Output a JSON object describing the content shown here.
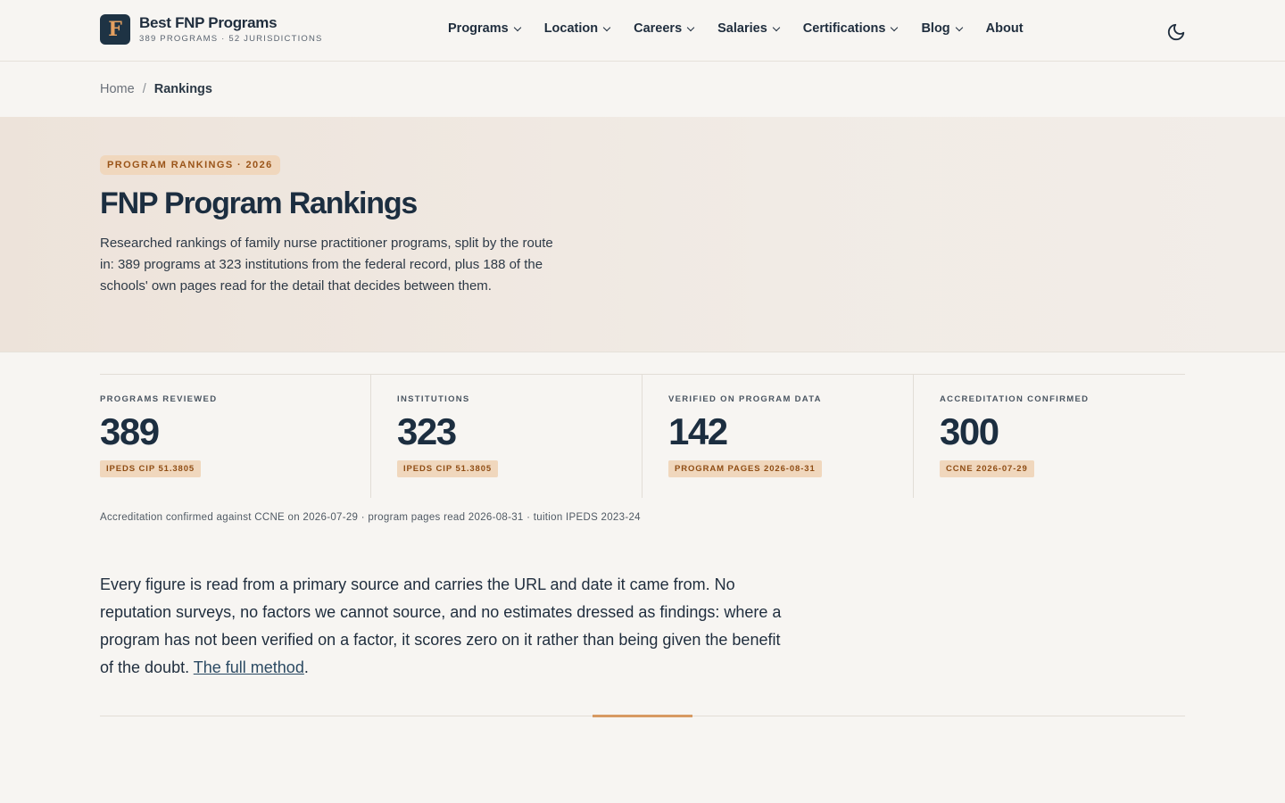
{
  "brand": {
    "logo_letter": "F",
    "name": "Best FNP Programs",
    "subtitle": "389 PROGRAMS · 52 JURISDICTIONS"
  },
  "nav": [
    {
      "label": "Programs",
      "has_dropdown": true
    },
    {
      "label": "Location",
      "has_dropdown": true
    },
    {
      "label": "Careers",
      "has_dropdown": true
    },
    {
      "label": "Salaries",
      "has_dropdown": true
    },
    {
      "label": "Certifications",
      "has_dropdown": true
    },
    {
      "label": "Blog",
      "has_dropdown": true
    },
    {
      "label": "About",
      "has_dropdown": false
    }
  ],
  "theme_toggle_icon": "moon-icon",
  "breadcrumb": {
    "home": "Home",
    "separator": "/",
    "current": "Rankings"
  },
  "hero": {
    "eyebrow": "PROGRAM RANKINGS · 2026",
    "title": "FNP Program Rankings",
    "description": "Researched rankings of family nurse practitioner programs, split by the route in: 389 programs at 323 institutions from the federal record, plus 188 of the schools' own pages read for the detail that decides between them."
  },
  "stats": [
    {
      "label": "PROGRAMS REVIEWED",
      "value": "389",
      "tag": "IPEDS CIP 51.3805"
    },
    {
      "label": "INSTITUTIONS",
      "value": "323",
      "tag": "IPEDS CIP 51.3805"
    },
    {
      "label": "VERIFIED ON PROGRAM DATA",
      "value": "142",
      "tag": "PROGRAM PAGES 2026-08-31"
    },
    {
      "label": "ACCREDITATION CONFIRMED",
      "value": "300",
      "tag": "CCNE 2026-07-29"
    }
  ],
  "footnote": "Accreditation confirmed against CCNE on 2026-07-29 · program pages read 2026-08-31 · tuition IPEDS 2023-24",
  "method": {
    "text": "Every figure is read from a primary source and carries the URL and date it came from. No reputation surveys, no factors we cannot source, and no estimates dressed as findings: where a program has not been verified on a factor, it scores zero on it rather than being given the benefit of the doubt. ",
    "link_label": "The full method",
    "trailing": "."
  },
  "colors": {
    "background": "#f7f5f2",
    "navy": "#1c2e40",
    "accent": "#d79a62",
    "tag_bg": "#f0d7bd",
    "tag_text": "#9a5418"
  }
}
